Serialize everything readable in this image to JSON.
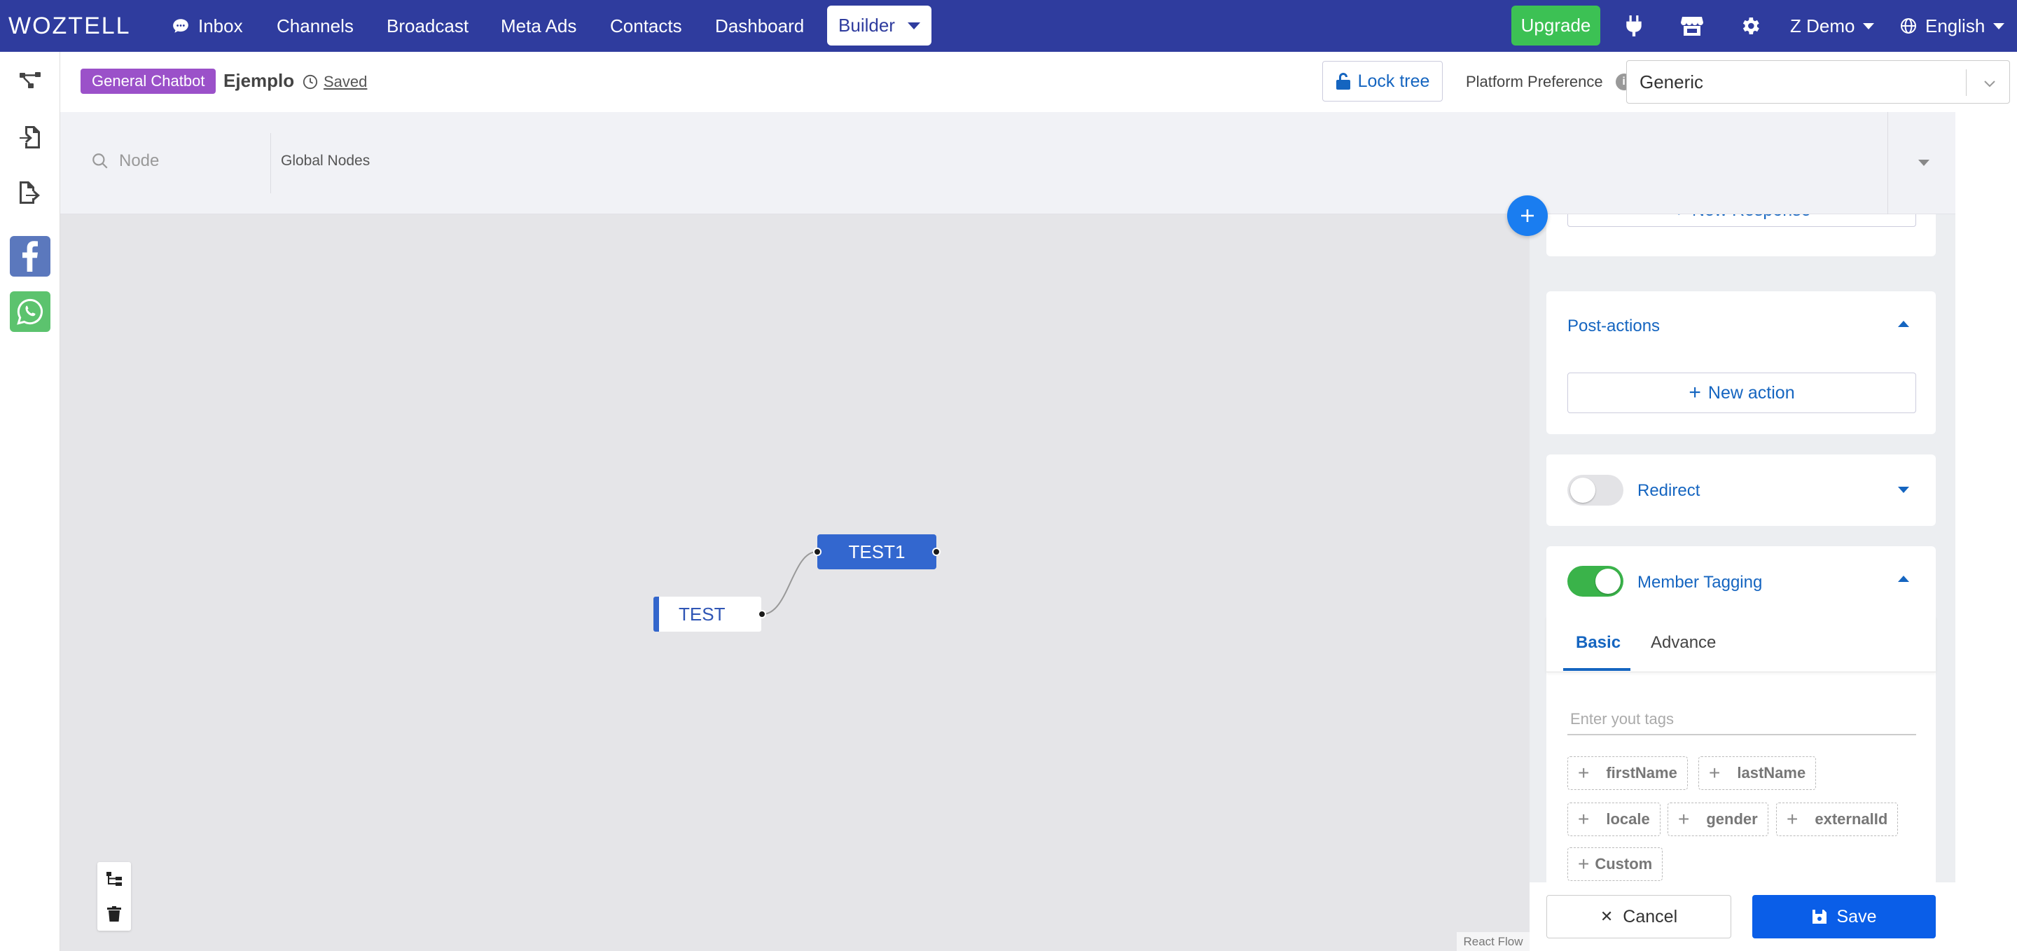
{
  "app": {
    "logo": "WOZTELL"
  },
  "nav": {
    "items": [
      "Inbox",
      "Channels",
      "Broadcast",
      "Meta Ads",
      "Contacts",
      "Dashboard"
    ],
    "builder": "Builder",
    "upgrade": "Upgrade",
    "account": "Z Demo",
    "language": "English"
  },
  "header": {
    "badge": "General Chatbot",
    "tree_name": "Ejemplo",
    "saved": "Saved",
    "lock_tree": "Lock tree",
    "platform_label": "Platform Preference",
    "platform_value": "Generic"
  },
  "search": {
    "placeholder": "Node",
    "global_nodes": "Global Nodes"
  },
  "canvas": {
    "nodes": [
      "TEST",
      "TEST1"
    ],
    "attribution": "React Flow"
  },
  "panel": {
    "new_response": "New Response",
    "post_actions": "Post-actions",
    "new_action": "New action",
    "redirect": "Redirect",
    "redirect_on": false,
    "member_tagging": "Member Tagging",
    "member_tagging_on": true,
    "tabs": [
      "Basic",
      "Advance"
    ],
    "tag_placeholder": "Enter yout tags",
    "chips": [
      "firstName",
      "lastName",
      "locale",
      "gender",
      "externalId",
      "Custom"
    ]
  },
  "footer": {
    "cancel": "Cancel",
    "save": "Save"
  },
  "colors": {
    "topbar": "#2f3c9e",
    "accent": "#1565c0",
    "upgrade": "#3cc154",
    "badge": "#9b51c9",
    "toggle_on": "#3ab34a",
    "node": "#3367cf",
    "save": "#0a5ee8"
  }
}
